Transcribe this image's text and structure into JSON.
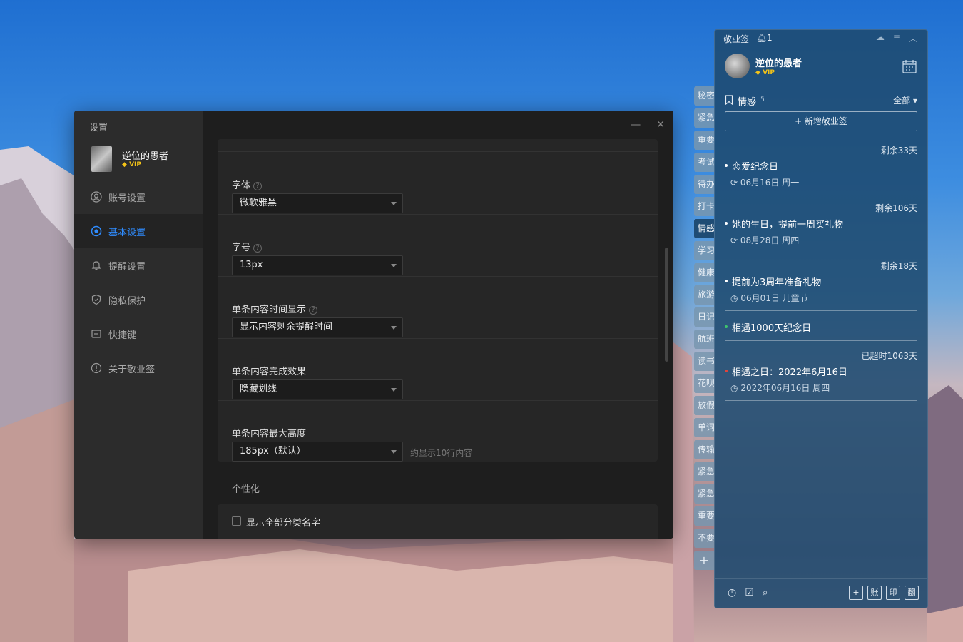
{
  "settings": {
    "title": "设置",
    "user": {
      "name": "逆位的愚者",
      "vip": "VIP"
    },
    "nav": [
      {
        "label": "账号设置",
        "icon": "user-circle-icon",
        "active": false
      },
      {
        "label": "基本设置",
        "icon": "radio-target-icon",
        "active": true
      },
      {
        "label": "提醒设置",
        "icon": "bell-icon",
        "active": false
      },
      {
        "label": "隐私保护",
        "icon": "shield-icon",
        "active": false
      },
      {
        "label": "快捷键",
        "icon": "keyboard-icon",
        "active": false
      },
      {
        "label": "关于敬业签",
        "icon": "info-icon",
        "active": false
      }
    ],
    "window_controls": {
      "minimize": "—",
      "close": "✕"
    },
    "rows": [
      {
        "label": "字体",
        "help": "?",
        "value": "微软雅黑"
      },
      {
        "label": "字号",
        "help": "?",
        "value": "13px"
      },
      {
        "label": "单条内容时间显示",
        "help": "?",
        "value": "显示内容剩余提醒时间"
      },
      {
        "label": "单条内容完成效果",
        "value": "隐藏划线"
      },
      {
        "label": "单条内容最大高度",
        "value": "185px（默认）",
        "hint": "约显示10行内容"
      }
    ],
    "personalize_title": "个性化",
    "checkbox_label": "显示全部分类名字"
  },
  "notes_panel": {
    "app_name": "敬业签",
    "notify_count": "1",
    "user": {
      "name": "逆位的愚者",
      "vip": "VIP"
    },
    "category": {
      "name": "情感",
      "count": "5",
      "filter": "全部"
    },
    "add_button": "+ 新增敬业签",
    "items": [
      {
        "remain": "剩余33天",
        "title": "恋爱纪念日",
        "meta": "06月16日 周一",
        "icon": "repeat-icon",
        "dot": "#ffffff"
      },
      {
        "remain": "剩余106天",
        "title": "她的生日，提前一周买礼物",
        "meta": "08月28日 周四",
        "icon": "repeat-icon",
        "dot": "#ffffff"
      },
      {
        "remain": "剩余18天",
        "title": "提前为3周年准备礼物",
        "meta": "06月01日 儿童节",
        "icon": "clock-icon",
        "dot": "#ffffff"
      },
      {
        "remain": "",
        "title": "相遇1000天纪念日",
        "meta": "",
        "icon": "",
        "dot": "#3ec46d"
      },
      {
        "remain": "已超时1063天",
        "title": "相遇之日：2022年6月16日",
        "meta": "2022年06月16日 周四",
        "icon": "clock-icon",
        "dot": "#e0443c"
      }
    ],
    "footer_right": [
      "+",
      "账",
      "印",
      "翻"
    ]
  },
  "tabs": [
    "秘密",
    "紧急",
    "重要",
    "考试",
    "待办",
    "打卡",
    "情感",
    "学习",
    "健康",
    "旅游",
    "日记",
    "航班",
    "读书",
    "花呗",
    "放假",
    "单词",
    "传输",
    "紧急",
    "紧急",
    "重要",
    "不要",
    "+"
  ],
  "active_tab_index": 6
}
